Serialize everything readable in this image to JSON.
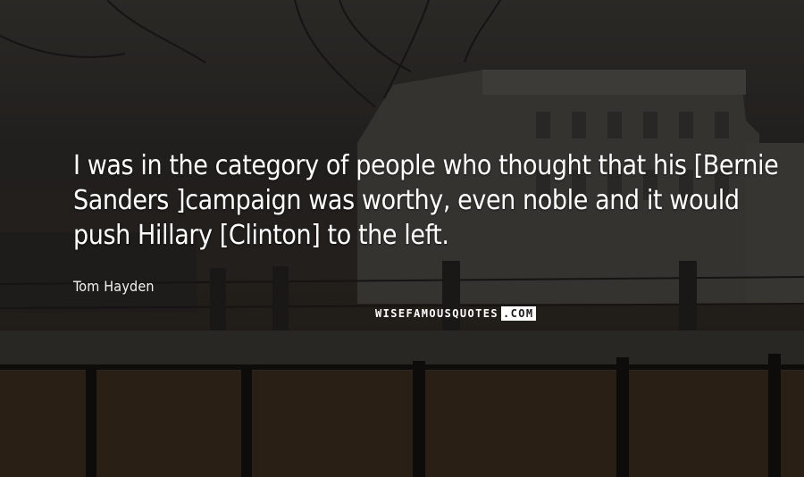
{
  "quote": {
    "text": "I was in the category of people who thought that his [Bernie Sanders ]campaign was worthy, even noble and it would push Hillary [Clinton] to the left.",
    "author": "Tom Hayden"
  },
  "watermark": {
    "name": "WISEFAMOUSQUOTES",
    "tld": ".COM"
  },
  "background": {
    "scene": "dim photo of a large palace facade behind iron railings, bare trees, lawn with a low post-and-rail fence",
    "tint": "#2f2c29"
  }
}
